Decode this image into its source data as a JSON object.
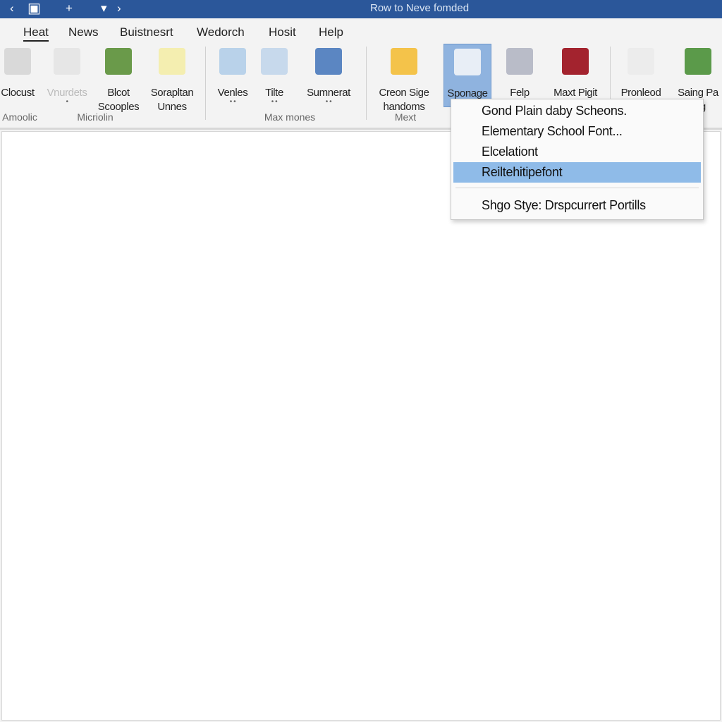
{
  "titlebar": {
    "title": "Row to Neve fomded",
    "back": "‹",
    "save": "▣",
    "add": "+",
    "dropdown": "▾",
    "forward": "›"
  },
  "tabs": [
    {
      "label": "Heat",
      "active": true
    },
    {
      "label": "News"
    },
    {
      "label": "Buistnesrt"
    },
    {
      "label": "Wedorch"
    },
    {
      "label": "Hosit"
    },
    {
      "label": "Help"
    }
  ],
  "ribbon": {
    "buttons": [
      {
        "label": "Clocust",
        "icon": "printer-icon",
        "color": "#d9d9d9"
      },
      {
        "label": "Vnurdets",
        "icon": "tools-icon",
        "disabled": true,
        "dots": "•",
        "color": "#e6e6e6"
      },
      {
        "label": "Blcot Scooples",
        "icon": "refresh-circle-icon",
        "color": "#6a9a4a"
      },
      {
        "label": "Sorapltan Unnes",
        "icon": "document-layout-icon",
        "color": "#f4eeb0"
      },
      {
        "label": "Venles",
        "icon": "table-grid-icon",
        "dots": "• •",
        "color": "#b9d2ea"
      },
      {
        "label": "Tilte",
        "icon": "book-open-icon",
        "dots": "• •",
        "color": "#c7d9ec"
      },
      {
        "label": "Sumnerat",
        "icon": "list-window-icon",
        "dots": "• •",
        "color": "#5b86c2"
      },
      {
        "label": "Creon Sige handoms",
        "icon": "folder-icon",
        "color": "#f4c34a"
      },
      {
        "label": "Sponage",
        "icon": "document-settings-icon",
        "selected": true,
        "color": "#e8eef6"
      },
      {
        "label": "Felp",
        "icon": "cloud-sync-icon",
        "color": "#b9bcc8"
      },
      {
        "label": "Maxt Pigit",
        "icon": "colored-book-icon",
        "color": "#a3232e"
      },
      {
        "label": "Pronleod",
        "icon": "calendar-icon",
        "color": "#ececec"
      },
      {
        "label": "Saing Pa ling",
        "icon": "chat-globe-icon",
        "color": "#5b9a4a"
      }
    ],
    "groups": [
      "Amoolic",
      "Micriolin",
      "Max mones",
      "Mext"
    ]
  },
  "menu": {
    "items": [
      "Gond Plain daby Scheons.",
      "Elementary School Font...",
      "Elcelationt",
      "Reiltehitipefont",
      "Shgo Stye: Drspcurrert Portills"
    ],
    "highlighted_index": 3
  },
  "colors": {
    "titlebar": "#2b579a",
    "selection": "#8fbbe8"
  }
}
